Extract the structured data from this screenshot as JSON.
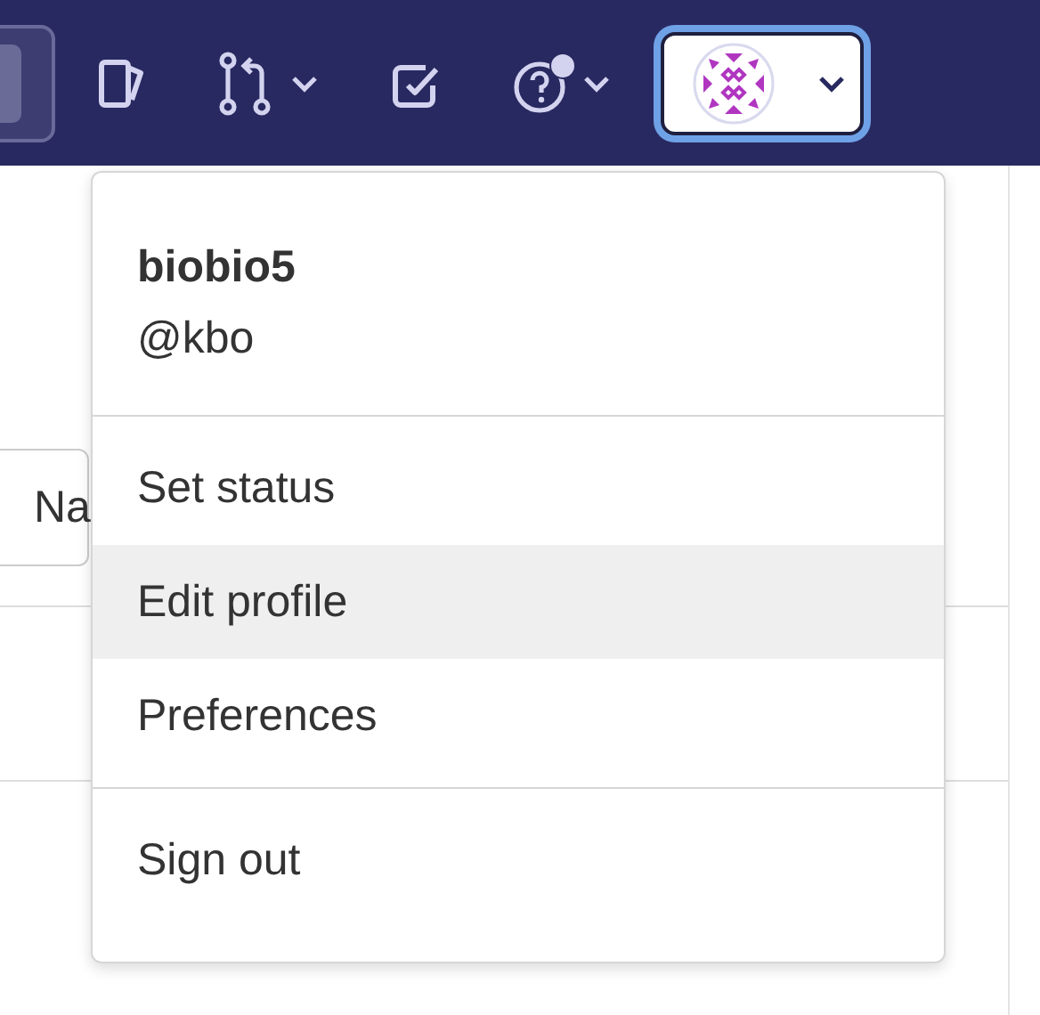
{
  "navbar": {
    "help": {
      "has_notification": true
    }
  },
  "page": {
    "button_label": "Na"
  },
  "user_menu": {
    "name": "biobio5",
    "handle": "@kbo",
    "sections": [
      {
        "items": [
          {
            "label": "Set status",
            "selected": false
          },
          {
            "label": "Edit profile",
            "selected": true
          },
          {
            "label": "Preferences",
            "selected": false
          }
        ]
      },
      {
        "items": [
          {
            "label": "Sign out",
            "selected": false
          }
        ]
      }
    ]
  }
}
